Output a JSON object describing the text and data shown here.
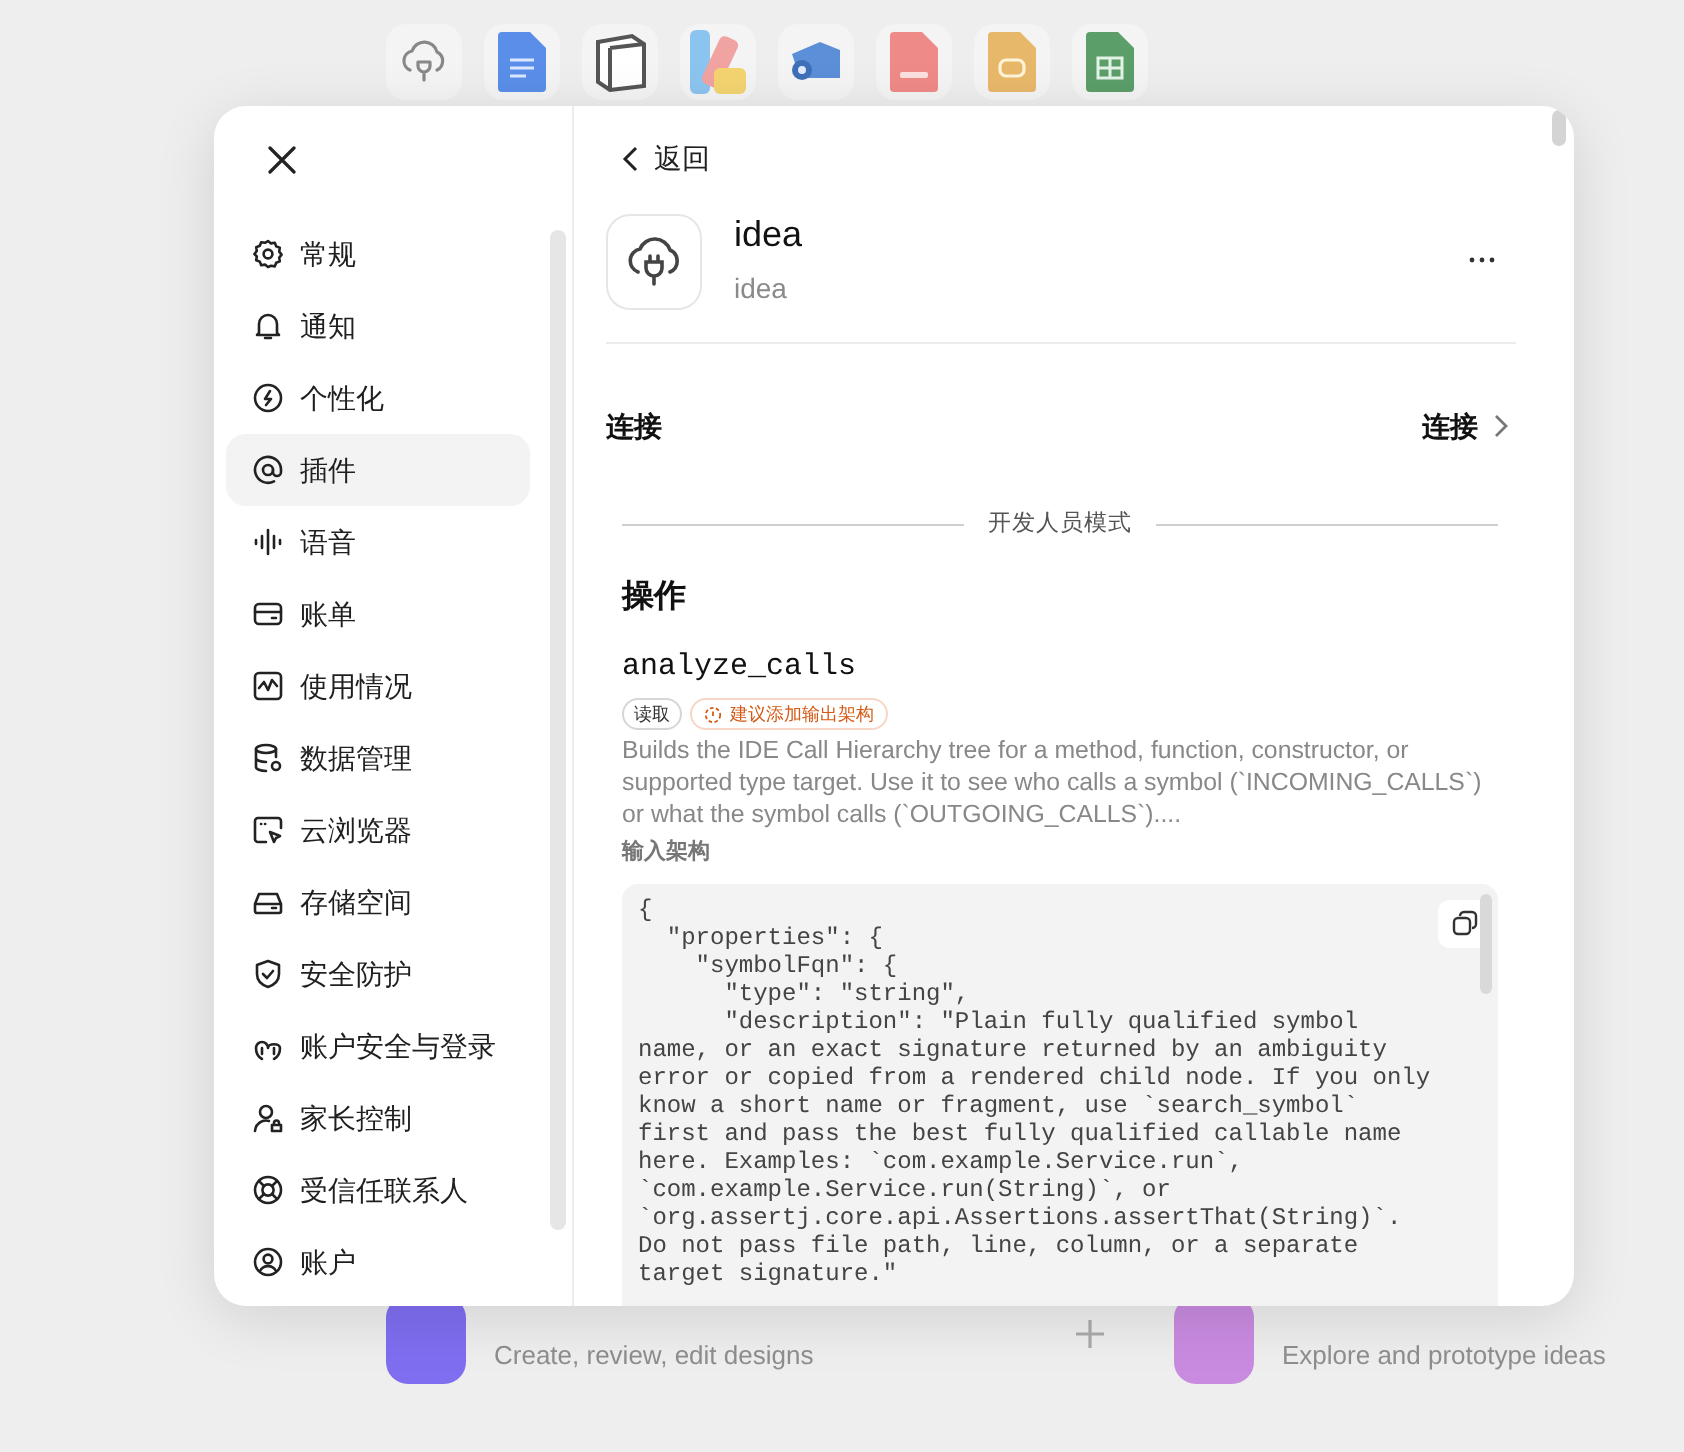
{
  "background": {
    "apps": [
      {
        "description": "Create, review, edit designs"
      },
      {
        "description": "Explore and prototype ideas"
      }
    ]
  },
  "sidebar": {
    "items": [
      {
        "label": "常规",
        "selected": false
      },
      {
        "label": "通知",
        "selected": false
      },
      {
        "label": "个性化",
        "selected": false
      },
      {
        "label": "插件",
        "selected": true
      },
      {
        "label": "语音",
        "selected": false
      },
      {
        "label": "账单",
        "selected": false
      },
      {
        "label": "使用情况",
        "selected": false
      },
      {
        "label": "数据管理",
        "selected": false
      },
      {
        "label": "云浏览器",
        "selected": false
      },
      {
        "label": "存储空间",
        "selected": false
      },
      {
        "label": "安全防护",
        "selected": false
      },
      {
        "label": "账户安全与登录",
        "selected": false
      },
      {
        "label": "家长控制",
        "selected": false
      },
      {
        "label": "受信任联系人",
        "selected": false
      },
      {
        "label": "账户",
        "selected": false
      }
    ]
  },
  "detail": {
    "back_label": "返回",
    "plugin": {
      "title": "idea",
      "subtitle": "idea"
    },
    "connection": {
      "label": "连接",
      "value": "连接"
    },
    "developer_divider": "开发人员模式",
    "actions_heading": "操作",
    "action": {
      "name": "analyze_calls",
      "tags": [
        {
          "label": "读取",
          "kind": "plain"
        },
        {
          "label": "建议添加输出架构",
          "kind": "warning"
        }
      ],
      "description": "Builds the IDE Call Hierarchy tree for a method, function, constructor, or supported type target. Use it to see who calls a symbol (`INCOMING_CALLS`) or what the symbol calls (`OUTGOING_CALLS`)....",
      "schema_label": "输入架构",
      "schema_lines": [
        "{",
        "  \"properties\": {",
        "    \"symbolFqn\": {",
        "      \"type\": \"string\",",
        "      \"description\": \"Plain fully qualified symbol",
        "name, or an exact signature returned by an ambiguity",
        "error or copied from a rendered child node. If you only",
        "know a short name or fragment, use `search_symbol`",
        "first and pass the best fully qualified callable name",
        "here. Examples: `com.example.Service.run`,",
        "`com.example.Service.run(String)`, or",
        "`org.assertj.core.api.Assertions.assertThat(String)`.",
        "Do not pass file path, line, column, or a separate",
        "target signature.\""
      ]
    }
  }
}
